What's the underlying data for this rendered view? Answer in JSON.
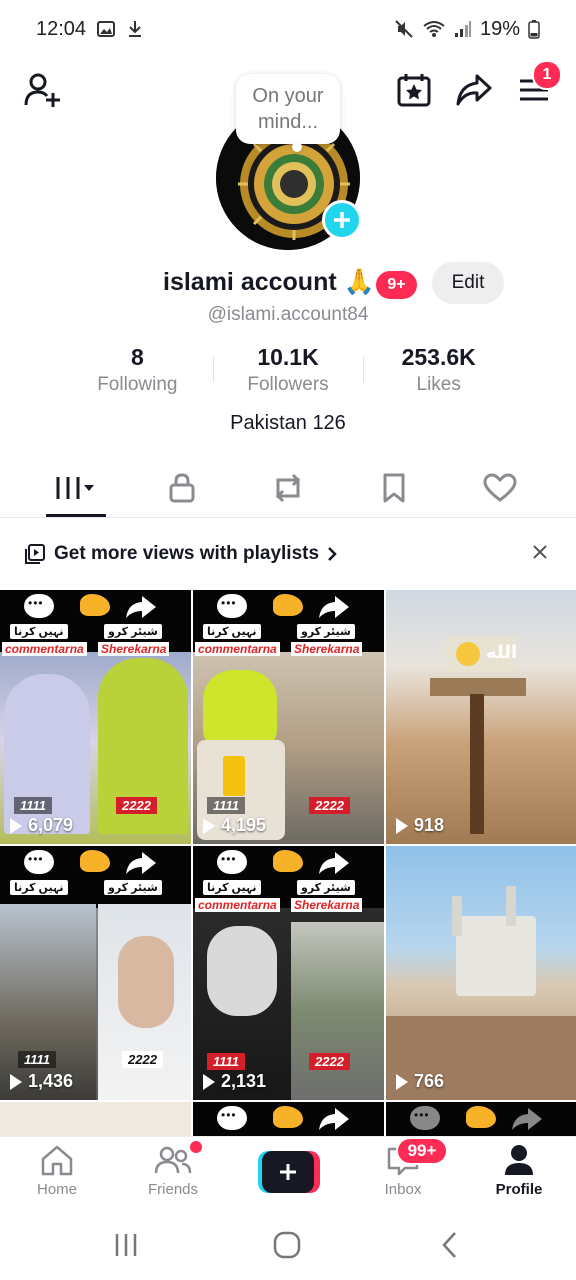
{
  "status_bar": {
    "time": "12:04",
    "battery": "19%"
  },
  "top_bar": {
    "menu_badge": "1"
  },
  "profile": {
    "bubble_text": "On your mind...",
    "name": "islami account 🙏",
    "name_badge": "9+",
    "edit_label": "Edit",
    "handle": "@islami.account84",
    "bio": "Pakistan 126"
  },
  "stats": [
    {
      "value": "8",
      "label": "Following"
    },
    {
      "value": "10.1K",
      "label": "Followers"
    },
    {
      "value": "253.6K",
      "label": "Likes"
    }
  ],
  "playlist_banner": {
    "text": "Get more views with playlists"
  },
  "videos": [
    {
      "views": "6,079",
      "tag_left": "1111",
      "tag_right": "2222",
      "cap_left": "commentarna",
      "cap_right": "Sherekarna",
      "pill_left": "نہیں کرنا",
      "pill_right": "شیئر کرو"
    },
    {
      "views": "4,195",
      "tag_left": "1111",
      "tag_right": "2222",
      "cap_left": "commentarna",
      "cap_right": "Sherekarna",
      "pill_left": "نہیں کرنا",
      "pill_right": "شیئر کرو"
    },
    {
      "views": "918",
      "overlay_text": "الله"
    },
    {
      "views": "1,436",
      "tag_left": "1111",
      "tag_right": "2222",
      "pill_left": "نہیں کرنا",
      "pill_right": "شیئر کرو"
    },
    {
      "views": "2,131",
      "tag_left": "1111",
      "tag_right": "2222",
      "cap_left": "commentarna",
      "cap_right": "Sherekarna",
      "pill_left": "نہیں کرنا",
      "pill_right": "شیئر کرو"
    },
    {
      "views": "766"
    }
  ],
  "bottom_nav": {
    "home": "Home",
    "friends": "Friends",
    "inbox": "Inbox",
    "inbox_badge": "99+",
    "profile": "Profile"
  },
  "colors": {
    "accent": "#fe2c55",
    "cyan": "#20d5ec",
    "text": "#161823",
    "muted": "#8a8b91"
  }
}
